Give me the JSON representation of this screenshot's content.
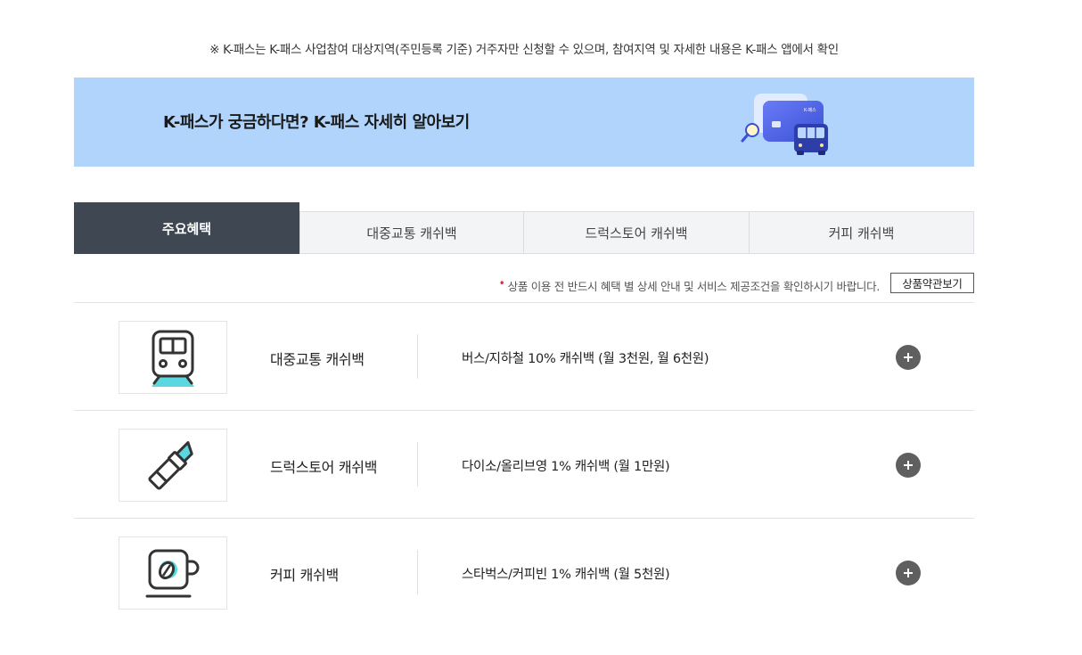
{
  "notice": "※ K-패스는 K-패스 사업참여 대상지역(주민등록 기준) 거주자만 신청할 수 있으며, 참여지역 및 자세한 내용은 K-패스 앱에서 확인",
  "banner": {
    "title": "K-패스가 궁금하다면? K-패스 자세히 알아보기",
    "card_text": "K-패스",
    "bg_color": "#b0d4fb"
  },
  "tabs": [
    {
      "label": "주요혜택",
      "active": true
    },
    {
      "label": "대중교통 캐쉬백",
      "active": false
    },
    {
      "label": "드럭스토어 캐쉬백",
      "active": false
    },
    {
      "label": "커피 캐쉬백",
      "active": false
    }
  ],
  "terms": {
    "bullet": "•",
    "notice": "상품 이용 전 반드시 혜택 별 상세 안내 및 서비스 제공조건을 확인하시기 바랍니다.",
    "button": "상품약관보기"
  },
  "benefits": [
    {
      "icon": "train-icon",
      "title": "대중교통 캐쉬백",
      "desc": "버스/지하철 10% 캐쉬백 (월 3천원, 월 6천원)"
    },
    {
      "icon": "lipstick-icon",
      "title": "드럭스토어 캐쉬백",
      "desc": "다이소/올리브영 1% 캐쉬백 (월 1만원)"
    },
    {
      "icon": "coffee-cup-icon",
      "title": "커피 캐쉬백",
      "desc": "스타벅스/커피빈 1% 캐쉬백 (월 5천원)"
    }
  ],
  "colors": {
    "active_tab": "#3f4753",
    "accent_cyan": "#5ad7e0",
    "plus_button": "#5f5f5f"
  }
}
